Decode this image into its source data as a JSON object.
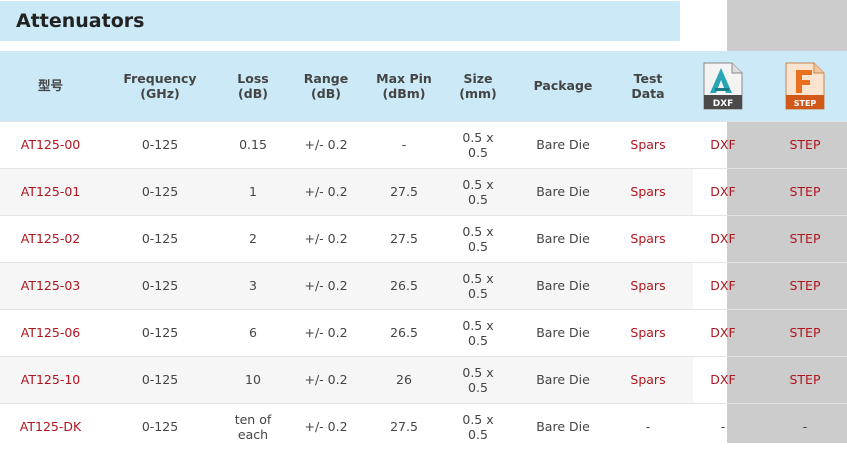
{
  "title": "Attenuators",
  "headers": {
    "model": "型号",
    "frequency": [
      "Frequency",
      "(GHz)"
    ],
    "loss": [
      "Loss",
      "(dB)"
    ],
    "range": [
      "Range",
      "(dB)"
    ],
    "max_pin": [
      "Max Pin",
      "(dBm)"
    ],
    "size": [
      "Size",
      "(mm)"
    ],
    "package": "Package",
    "test_data": [
      "Test",
      "Data"
    ],
    "dxf_icon_label": "DXF",
    "step_icon_label": "STEP"
  },
  "rows": [
    {
      "model": "AT125-00",
      "frequency": "0-125",
      "loss": [
        "0.15"
      ],
      "range": "+/- 0.2",
      "max_pin": "-",
      "size": [
        "0.5 x",
        "0.5"
      ],
      "package": "Bare Die",
      "test_data": "Spars",
      "dxf": "DXF",
      "step": "STEP"
    },
    {
      "model": "AT125-01",
      "frequency": "0-125",
      "loss": [
        "1"
      ],
      "range": "+/- 0.2",
      "max_pin": "27.5",
      "size": [
        "0.5 x",
        "0.5"
      ],
      "package": "Bare Die",
      "test_data": "Spars",
      "dxf": "DXF",
      "step": "STEP"
    },
    {
      "model": "AT125-02",
      "frequency": "0-125",
      "loss": [
        "2"
      ],
      "range": "+/- 0.2",
      "max_pin": "27.5",
      "size": [
        "0.5 x",
        "0.5"
      ],
      "package": "Bare Die",
      "test_data": "Spars",
      "dxf": "DXF",
      "step": "STEP"
    },
    {
      "model": "AT125-03",
      "frequency": "0-125",
      "loss": [
        "3"
      ],
      "range": "+/- 0.2",
      "max_pin": "26.5",
      "size": [
        "0.5 x",
        "0.5"
      ],
      "package": "Bare Die",
      "test_data": "Spars",
      "dxf": "DXF",
      "step": "STEP"
    },
    {
      "model": "AT125-06",
      "frequency": "0-125",
      "loss": [
        "6"
      ],
      "range": "+/- 0.2",
      "max_pin": "26.5",
      "size": [
        "0.5 x",
        "0.5"
      ],
      "package": "Bare Die",
      "test_data": "Spars",
      "dxf": "DXF",
      "step": "STEP"
    },
    {
      "model": "AT125-10",
      "frequency": "0-125",
      "loss": [
        "10"
      ],
      "range": "+/- 0.2",
      "max_pin": "26",
      "size": [
        "0.5 x",
        "0.5"
      ],
      "package": "Bare Die",
      "test_data": "Spars",
      "dxf": "DXF",
      "step": "STEP"
    },
    {
      "model": "AT125-DK",
      "frequency": "0-125",
      "loss": [
        "ten of",
        "each"
      ],
      "range": "+/- 0.2",
      "max_pin": "27.5",
      "size": [
        "0.5 x",
        "0.5"
      ],
      "package": "Bare Die",
      "test_data": "-",
      "dxf": "-",
      "step": "-"
    }
  ],
  "colors": {
    "header_bg": "#cce9f8",
    "link": "#b0151e",
    "side_panel": "#cccccc",
    "dxf_icon_accent": "#2aa5b5",
    "step_icon_accent": "#e8701e"
  }
}
